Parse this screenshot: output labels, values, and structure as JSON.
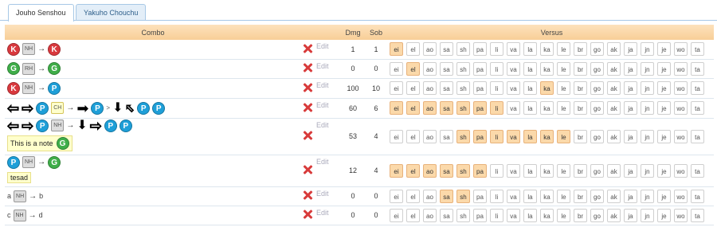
{
  "tabs": [
    "Jouho Senshou",
    "Yakuho Chouchu"
  ],
  "headers": {
    "combo": "Combo",
    "dmg": "Dmg",
    "sob": "Sob",
    "versus": "Versus"
  },
  "edit_label": "Edit",
  "arrow": "→",
  "opponents": [
    "ei",
    "el",
    "ao",
    "sa",
    "sh",
    "pa",
    "li",
    "va",
    "la",
    "ka",
    "le",
    "br",
    "go",
    "ak",
    "ja",
    "jn",
    "je",
    "wo",
    "ta"
  ],
  "rows": [
    {
      "dmg": "1",
      "sob": "1",
      "on": [
        0
      ],
      "combo": [
        {
          "t": "btn",
          "v": "K"
        },
        {
          "t": "tag",
          "v": "NH"
        },
        {
          "t": "arrow"
        },
        {
          "t": "btn",
          "v": "K"
        }
      ]
    },
    {
      "dmg": "0",
      "sob": "0",
      "on": [
        1
      ],
      "combo": [
        {
          "t": "btn",
          "v": "G"
        },
        {
          "t": "tag",
          "v": "RH"
        },
        {
          "t": "arrow"
        },
        {
          "t": "btn",
          "v": "G"
        }
      ]
    },
    {
      "dmg": "100",
      "sob": "10",
      "on": [
        9
      ],
      "combo": [
        {
          "t": "btn",
          "v": "K"
        },
        {
          "t": "tag",
          "v": "NH"
        },
        {
          "t": "arrow"
        },
        {
          "t": "btn",
          "v": "P"
        }
      ]
    },
    {
      "dmg": "60",
      "sob": "6",
      "on": [
        0,
        1,
        2,
        3,
        4,
        5,
        6
      ],
      "combo": [
        {
          "t": "dir",
          "v": "left"
        },
        {
          "t": "dir",
          "v": "right-hollow"
        },
        {
          "t": "btn",
          "v": "P"
        },
        {
          "t": "tag",
          "v": "CH",
          "cls": "ch"
        },
        {
          "t": "arrow"
        },
        {
          "t": "dir",
          "v": "right"
        },
        {
          "t": "btn",
          "v": "P"
        },
        {
          "t": "sep",
          "v": ">"
        },
        {
          "t": "dir",
          "v": "down"
        },
        {
          "t": "dir",
          "v": "upleft"
        },
        {
          "t": "btn",
          "v": "P"
        },
        {
          "t": "btn",
          "v": "P"
        }
      ]
    },
    {
      "dmg": "53",
      "sob": "4",
      "on": [
        4,
        5,
        6,
        7,
        8,
        9,
        10
      ],
      "combo": [
        {
          "t": "dir",
          "v": "left"
        },
        {
          "t": "dir",
          "v": "right-hollow"
        },
        {
          "t": "btn",
          "v": "P"
        },
        {
          "t": "tag",
          "v": "NH"
        },
        {
          "t": "arrow"
        },
        {
          "t": "dir",
          "v": "down"
        },
        {
          "t": "dir",
          "v": "right-hollow"
        },
        {
          "t": "btn",
          "v": "P"
        },
        {
          "t": "btn",
          "v": "P"
        }
      ],
      "note": {
        "text": "This is a note",
        "btn": "G"
      }
    },
    {
      "dmg": "12",
      "sob": "4",
      "on": [
        0,
        1,
        2,
        3,
        4,
        5
      ],
      "combo": [
        {
          "t": "btn",
          "v": "P"
        },
        {
          "t": "tag",
          "v": "NH"
        },
        {
          "t": "arrow"
        },
        {
          "t": "btn",
          "v": "G"
        }
      ],
      "note": {
        "text": "tesad"
      }
    },
    {
      "dmg": "0",
      "sob": "0",
      "on": [
        3,
        4
      ],
      "combo": [
        {
          "t": "plain",
          "v": "a"
        },
        {
          "t": "tag",
          "v": "NH"
        },
        {
          "t": "arrow"
        },
        {
          "t": "plain",
          "v": "b"
        }
      ]
    },
    {
      "dmg": "0",
      "sob": "0",
      "on": [],
      "combo": [
        {
          "t": "plain",
          "v": "c"
        },
        {
          "t": "tag",
          "v": "NH"
        },
        {
          "t": "arrow"
        },
        {
          "t": "plain",
          "v": "d"
        }
      ]
    }
  ],
  "colors": {
    "K": "#d9393e",
    "G": "#3fae49",
    "P": "#1e9fd8",
    "header": "#fbd9aa",
    "selected": "#fbd9aa"
  }
}
